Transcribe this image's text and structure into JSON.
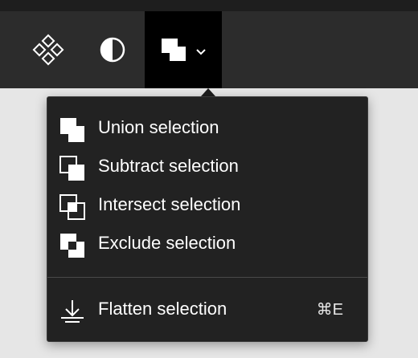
{
  "toolbar": {
    "tools": [
      {
        "name": "components",
        "icon": "components-icon"
      },
      {
        "name": "mask",
        "icon": "mask-icon"
      },
      {
        "name": "boolean-operations",
        "icon": "union-icon",
        "active": true,
        "dropdown_icon": "chevron-down-icon"
      }
    ]
  },
  "menu": {
    "items": [
      {
        "label": "Union selection",
        "icon": "union-icon"
      },
      {
        "label": "Subtract selection",
        "icon": "subtract-icon"
      },
      {
        "label": "Intersect selection",
        "icon": "intersect-icon"
      },
      {
        "label": "Exclude selection",
        "icon": "exclude-icon"
      }
    ],
    "flatten": {
      "label": "Flatten selection",
      "icon": "flatten-icon",
      "shortcut": "⌘E"
    }
  },
  "colors": {
    "toolbar_bg": "#2c2c2c",
    "active_tool_bg": "#000000",
    "menu_bg": "#222222",
    "canvas_bg": "#e6e6e6",
    "text": "#ffffff"
  }
}
